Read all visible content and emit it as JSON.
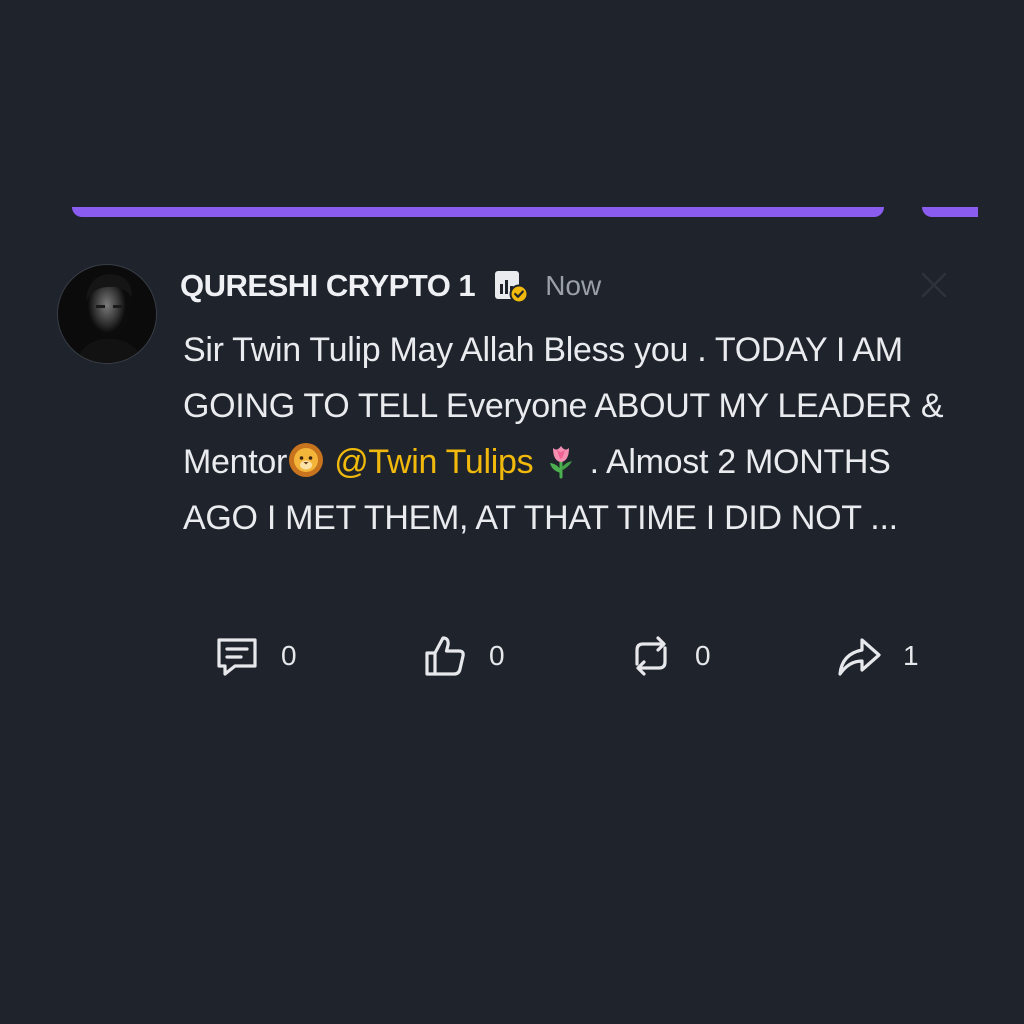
{
  "post": {
    "author": "QURESHI CRYPTO 1",
    "time": "Now",
    "text": {
      "part1": "Sir Twin Tulip May Allah Bless you . TODAY I AM GOING TO TELL Everyone ABOUT MY LEADER & Mentor",
      "mention": "@Twin Tulips",
      "part2": ". Almost 2 MONTHS AGO I MET THEM, AT THAT TIME I DID NOT ..."
    },
    "actions": {
      "comments": "0",
      "likes": "0",
      "reposts": "0",
      "shares": "1"
    }
  },
  "icons": {
    "verified": "creator-verified-icon",
    "lion": "lion-emoji",
    "tulip": "tulip-emoji",
    "close": "close-icon",
    "comment": "comment-icon",
    "like": "thumbs-up-icon",
    "repost": "repost-icon",
    "share": "share-icon"
  },
  "colors": {
    "background": "#1f232c",
    "accent": "#8a5cf0",
    "mention": "#f0b90b",
    "badge_check": "#f0b90b"
  }
}
